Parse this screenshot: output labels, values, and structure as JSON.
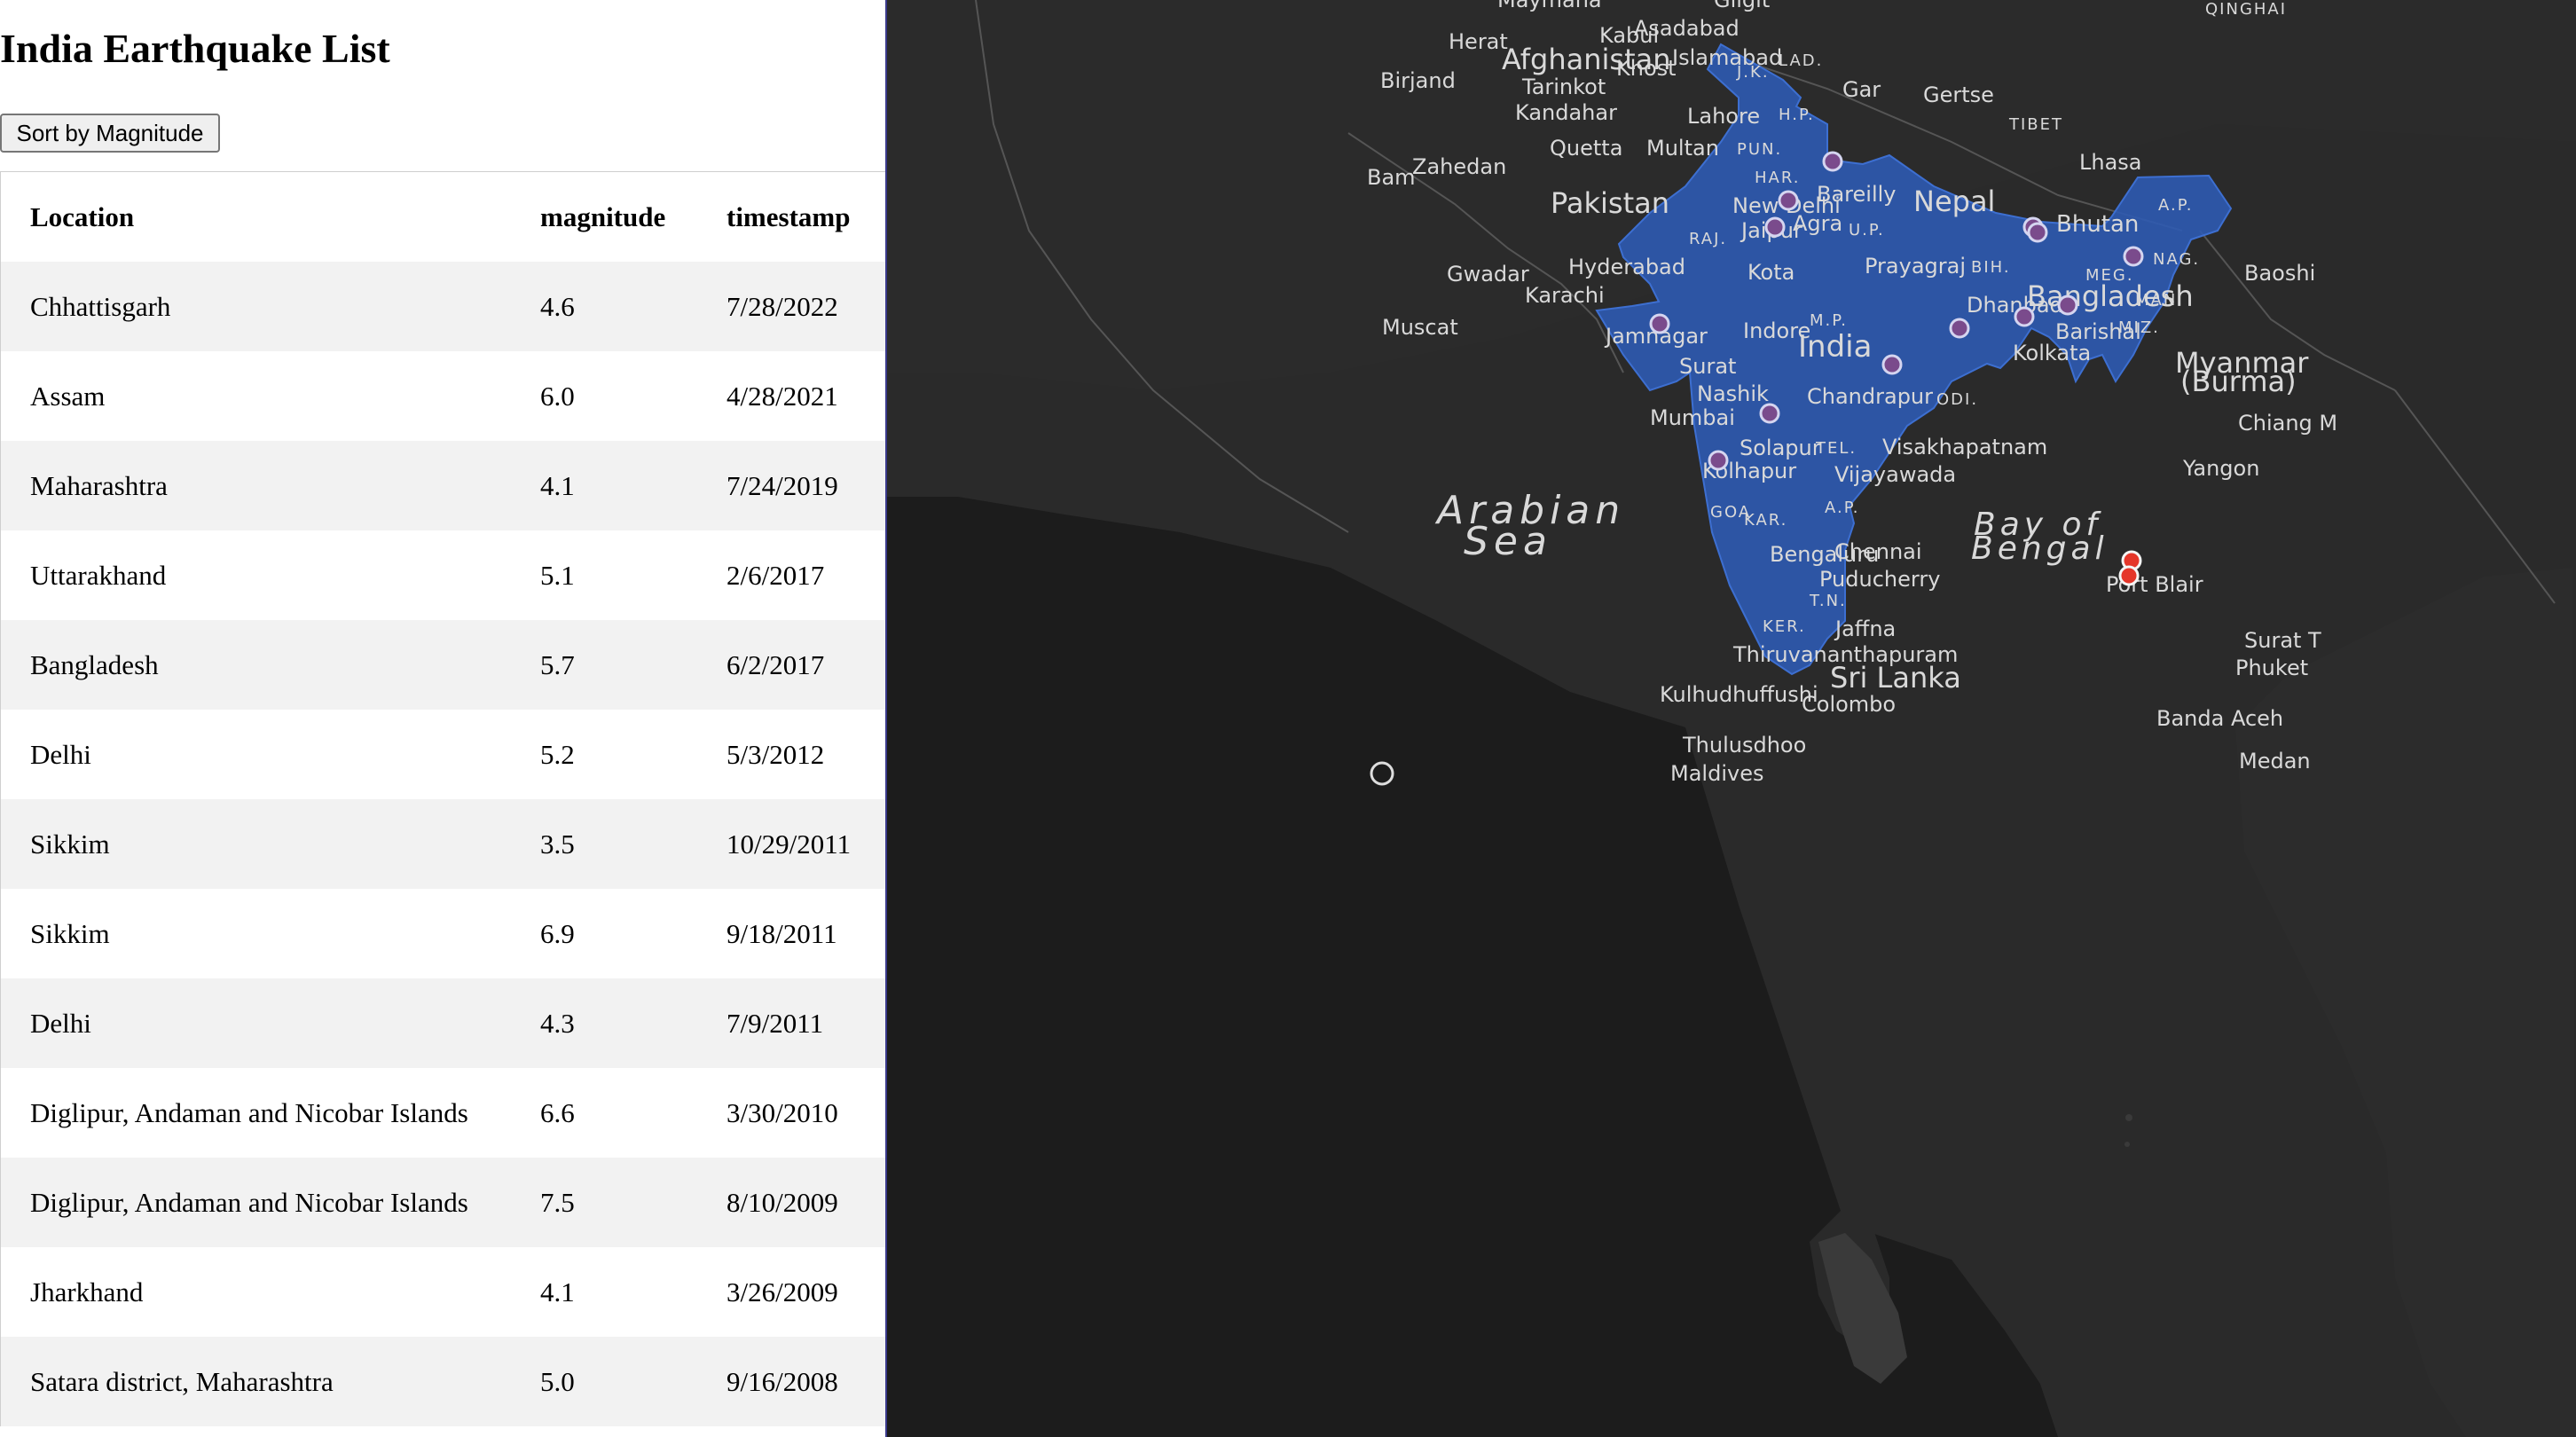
{
  "page": {
    "title": "India Earthquake List",
    "sort_button_label": "Sort by Magnitude"
  },
  "table": {
    "columns": [
      "Location",
      "magnitude",
      "timestamp"
    ],
    "rows": [
      {
        "location": "Chhattisgarh",
        "magnitude": "4.6",
        "timestamp": "7/28/2022"
      },
      {
        "location": "Assam",
        "magnitude": "6.0",
        "timestamp": "4/28/2021"
      },
      {
        "location": "Maharashtra",
        "magnitude": "4.1",
        "timestamp": "7/24/2019"
      },
      {
        "location": "Uttarakhand",
        "magnitude": "5.1",
        "timestamp": "2/6/2017"
      },
      {
        "location": "Bangladesh",
        "magnitude": "5.7",
        "timestamp": "6/2/2017"
      },
      {
        "location": "Delhi",
        "magnitude": "5.2",
        "timestamp": "5/3/2012"
      },
      {
        "location": "Sikkim",
        "magnitude": "3.5",
        "timestamp": "10/29/2011"
      },
      {
        "location": "Sikkim",
        "magnitude": "6.9",
        "timestamp": "9/18/2011"
      },
      {
        "location": "Delhi",
        "magnitude": "4.3",
        "timestamp": "7/9/2011"
      },
      {
        "location": "Diglipur, Andaman and Nicobar Islands",
        "magnitude": "6.6",
        "timestamp": "3/30/2010"
      },
      {
        "location": "Diglipur, Andaman and Nicobar Islands",
        "magnitude": "7.5",
        "timestamp": "8/10/2009"
      },
      {
        "location": "Jharkhand",
        "magnitude": "4.1",
        "timestamp": "3/26/2009"
      },
      {
        "location": "Satara district, Maharashtra",
        "magnitude": "5.0",
        "timestamp": "9/16/2008"
      }
    ]
  },
  "map": {
    "labels": {
      "countries": [
        "Afghanistan",
        "Pakistan",
        "Nepal",
        "Bhutan",
        "India",
        "Bangladesh",
        "Sri Lanka",
        "Myanmar",
        "(Burma)"
      ],
      "seas": [
        "Arabian",
        "Sea",
        "Bay of",
        "Bengal"
      ],
      "cities": [
        "Maymana",
        "Gilgit",
        "Herat",
        "Kabul",
        "Asadabad",
        "Islamabad",
        "Birjand",
        "Khost",
        "Tarinkot",
        "Kandahar",
        "Lahore",
        "Gar",
        "Gertse",
        "Quetta",
        "Multan",
        "Zahedan",
        "Bam",
        "Lhasa",
        "New Delhi",
        "Bareilly",
        "Jaipur",
        "Agra",
        "Hyderabad",
        "Gwadar",
        "Kota",
        "Prayagraj",
        "Karachi",
        "Muscat",
        "Jamnagar",
        "Indore",
        "Dhanbad",
        "Barishal",
        "Kolkata",
        "Surat",
        "Nashik",
        "Chandrapur",
        "Mumbai",
        "Solapur",
        "Visakhapatnam",
        "Kolhapur",
        "Vijayawada",
        "Bengaluru",
        "Chennai",
        "Puducherry",
        "Jaffna",
        "Thiruvananthapuram",
        "Colombo",
        "Kulhudhuffushi",
        "Thulusdhoo",
        "Port Blair",
        "Yangon",
        "Chiang M",
        "Surat T",
        "Phuket",
        "Banda Aceh",
        "Medan",
        "Baoshi",
        "Maldives"
      ],
      "regions": [
        "QINGHAI",
        "LAD.",
        "J.K.",
        "H.P.",
        "TIBET",
        "PUN.",
        "HAR.",
        "U.P.",
        "RAJ.",
        "BIH.",
        "A.P.",
        "MEG.",
        "NAG.",
        "MAN.",
        "MIZ.",
        "M.P.",
        "ODI.",
        "TEL.",
        "A.P.",
        "GOA",
        "KAR.",
        "T.N.",
        "KER."
      ]
    },
    "colors": {
      "background": "#1c1c1c",
      "india_fill": "#2d5bb5",
      "marker_fill": "#7a4b8c",
      "marker_stroke": "#d5d5f0",
      "marker_red": "#e5362a"
    },
    "markers_on_mainland": 15,
    "markers_red": 2
  }
}
